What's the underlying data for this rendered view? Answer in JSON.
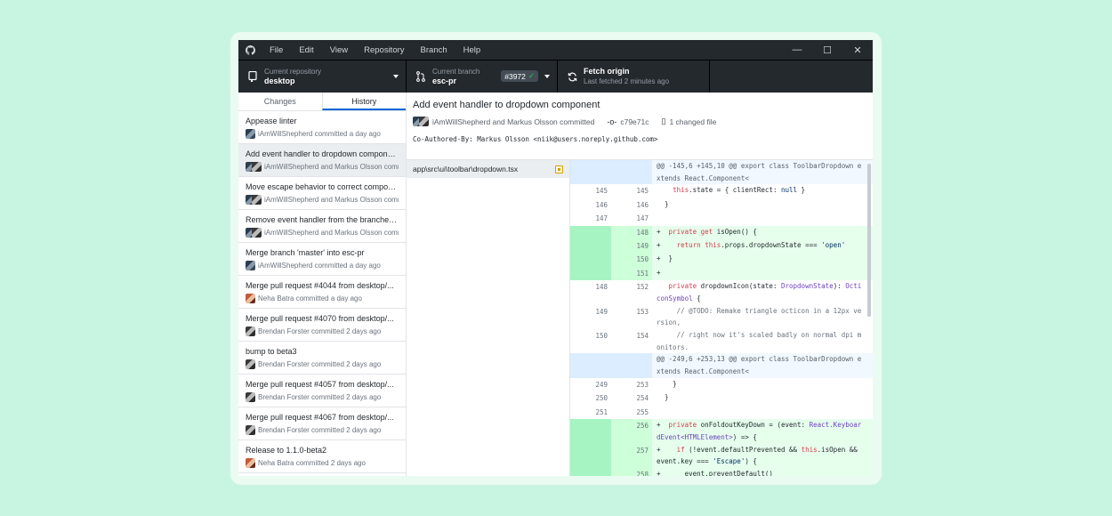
{
  "menu": [
    "File",
    "Edit",
    "View",
    "Repository",
    "Branch",
    "Help"
  ],
  "window_controls": [
    "—",
    "☐",
    "✕"
  ],
  "toolbar": {
    "repo_label": "Current repository",
    "repo_value": "desktop",
    "branch_label": "Current branch",
    "branch_value": "esc-pr",
    "pr_number": "#3972",
    "fetch_title": "Fetch origin",
    "fetch_sub": "Last fetched 2 minutes ago"
  },
  "tabs": {
    "changes": "Changes",
    "history": "History"
  },
  "commits": [
    {
      "title": "Appease linter",
      "meta": "iAmWillShepherd committed a day ago",
      "avatars": [
        "a1"
      ]
    },
    {
      "title": "Add event handler to dropdown component",
      "meta": "iAmWillShepherd and Markus Olsson committed a day ago",
      "avatars": [
        "a1",
        "a3"
      ]
    },
    {
      "title": "Move escape behavior to correct component",
      "meta": "iAmWillShepherd and Markus Olsson committed a day ago",
      "avatars": [
        "a1",
        "a3"
      ]
    },
    {
      "title": "Remove event handler from the branches list",
      "meta": "iAmWillShepherd and Markus Olsson committed a day ago",
      "avatars": [
        "a1",
        "a3"
      ]
    },
    {
      "title": "Merge branch 'master' into esc-pr",
      "meta": "iAmWillShepherd committed a day ago",
      "avatars": [
        "a1"
      ]
    },
    {
      "title": "Merge pull request #4044 from desktop/...",
      "meta": "Neha Batra committed a day ago",
      "avatars": [
        "a4"
      ]
    },
    {
      "title": "Merge pull request #4070 from desktop/...",
      "meta": "Brendan Forster committed 2 days ago",
      "avatars": [
        "a3"
      ]
    },
    {
      "title": "bump to beta3",
      "meta": "Brendan Forster committed 2 days ago",
      "avatars": [
        "a3"
      ]
    },
    {
      "title": "Merge pull request #4057 from desktop/...",
      "meta": "Brendan Forster committed 2 days ago",
      "avatars": [
        "a3"
      ]
    },
    {
      "title": "Merge pull request #4067 from desktop/...",
      "meta": "Brendan Forster committed 2 days ago",
      "avatars": [
        "a3"
      ]
    },
    {
      "title": "Release to 1.1.0-beta2",
      "meta": "Neha Batra committed 2 days ago",
      "avatars": [
        "a4"
      ]
    }
  ],
  "detail": {
    "title": "Add event handler to dropdown component",
    "authors": "iAmWillShepherd and Markus Olsson committed",
    "sha": "c79e71c",
    "changed": "1 changed file",
    "body": "Co-Authored-By: Markus Olsson <niik@users.noreply.github.com>"
  },
  "file": "app\\src\\ui\\toolbar\\dropdown.tsx",
  "diff": [
    {
      "type": "hunk",
      "old": "",
      "new": "",
      "html": "@@ -145,6 +145,10 @@ export class ToolbarDropdown extends React.Component<"
    },
    {
      "type": "ctx",
      "old": "145",
      "new": "145",
      "html": "    <span class='kw'>this</span>.state = { clientRect: <span class='str'>null</span> }"
    },
    {
      "type": "ctx",
      "old": "146",
      "new": "146",
      "html": "  }"
    },
    {
      "type": "ctx",
      "old": "147",
      "new": "147",
      "html": ""
    },
    {
      "type": "add",
      "old": "",
      "new": "148",
      "html": "+  <span class='kw'>private</span> <span class='kw'>get</span> isOpen() {"
    },
    {
      "type": "add",
      "old": "",
      "new": "149",
      "html": "+    <span class='kw'>return</span> <span class='kw'>this</span>.props.dropdownState === <span class='str'>'open'</span>"
    },
    {
      "type": "add",
      "old": "",
      "new": "150",
      "html": "+  }"
    },
    {
      "type": "add",
      "old": "",
      "new": "151",
      "html": "+"
    },
    {
      "type": "ctx",
      "old": "148",
      "new": "152",
      "html": "   <span class='kw'>private</span> dropdownIcon(state: <span class='ty'>DropdownState</span>): <span class='ty'>OcticonSymbol</span> {"
    },
    {
      "type": "ctx",
      "old": "149",
      "new": "153",
      "html": "     <span class='cm'>// @TODO: Remake triangle octicon in a 12px version,</span>"
    },
    {
      "type": "ctx",
      "old": "150",
      "new": "154",
      "html": "     <span class='cm'>// right now it's scaled badly on normal dpi monitors.</span>"
    },
    {
      "type": "hunk",
      "old": "",
      "new": "",
      "html": "@@ -249,6 +253,13 @@ export class ToolbarDropdown extends React.Component<"
    },
    {
      "type": "ctx",
      "old": "249",
      "new": "253",
      "html": "    }"
    },
    {
      "type": "ctx",
      "old": "250",
      "new": "254",
      "html": "  }"
    },
    {
      "type": "ctx",
      "old": "251",
      "new": "255",
      "html": ""
    },
    {
      "type": "add",
      "old": "",
      "new": "256",
      "html": "+  <span class='kw'>private</span> onFoldoutKeyDown = (event: <span class='ty'>React.KeyboardEvent&lt;HTMLElement&gt;</span>) => {"
    },
    {
      "type": "add",
      "old": "",
      "new": "257",
      "html": "+    <span class='kw'>if</span> (!event.defaultPrevented &amp;&amp; <span class='kw'>this</span>.isOpen &amp;&amp; event.key === <span class='str'>'Escape'</span>) {"
    },
    {
      "type": "add",
      "old": "",
      "new": "258",
      "html": "+      event.preventDefault()"
    }
  ]
}
